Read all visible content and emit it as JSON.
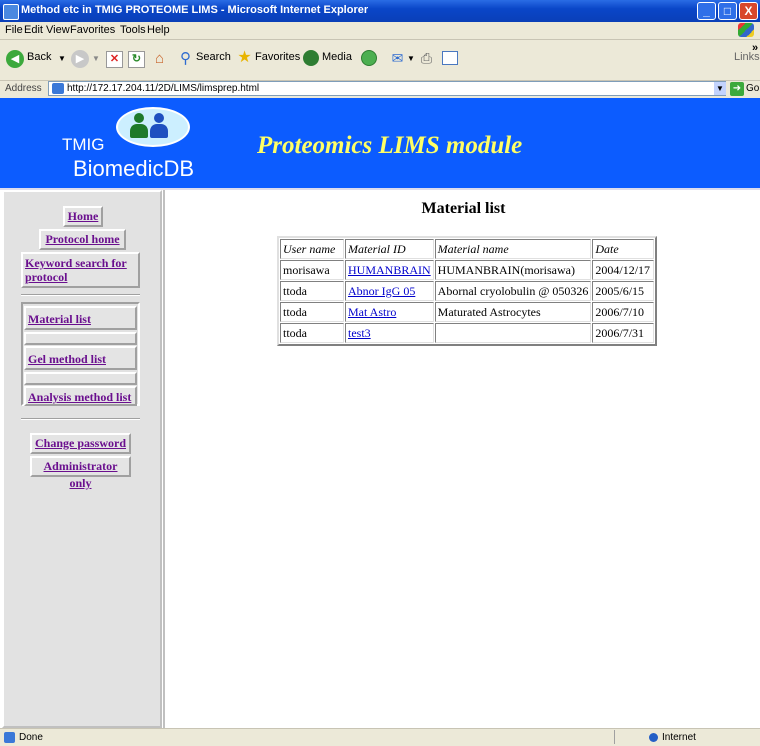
{
  "window": {
    "title": "Method etc in TMIG PROTEOME LIMS - Microsoft Internet Explorer",
    "minimize": "_",
    "maximize": "□",
    "close": "X"
  },
  "menu": [
    "File",
    "Edit",
    "View",
    "Favorites",
    "Tools",
    "Help"
  ],
  "toolbar": {
    "back": "Back",
    "search": "Search",
    "favorites": "Favorites",
    "media": "Media",
    "links": "Links",
    "more": "»"
  },
  "address": {
    "label": "Address",
    "url": "http://172.17.204.11/2D/LIMS/limsprep.html",
    "go": "Go"
  },
  "banner": {
    "logo_line1": "TMIG",
    "logo_line2": "BiomedicDB",
    "title": "Proteomics LIMS module"
  },
  "sidebar": {
    "home": "Home",
    "protocol_home": "Protocol home",
    "keyword_search_line1": "Keyword search for",
    "keyword_search_line2": "protocol",
    "material_list": "Material list",
    "gel_method_list": "Gel method list",
    "analysis_method_list": "Analysis method list",
    "change_password": "Change password",
    "administrator_only": "Administrator only"
  },
  "main": {
    "heading": "Material list",
    "columns": [
      "User name",
      "Material ID",
      "Material name",
      "Date"
    ],
    "rows": [
      [
        "morisawa",
        "HUMANBRAIN",
        "HUMANBRAIN(morisawa)",
        "2004/12/17"
      ],
      [
        "ttoda",
        "Abnor IgG 05",
        "Abornal cryolobulin @ 050326",
        "2005/6/15"
      ],
      [
        "ttoda",
        "Mat Astro",
        "Maturated Astrocytes",
        "2006/7/10"
      ],
      [
        "ttoda",
        "test3",
        "",
        "2006/7/31"
      ]
    ]
  },
  "status": {
    "text": "Done",
    "zone": "Internet"
  }
}
